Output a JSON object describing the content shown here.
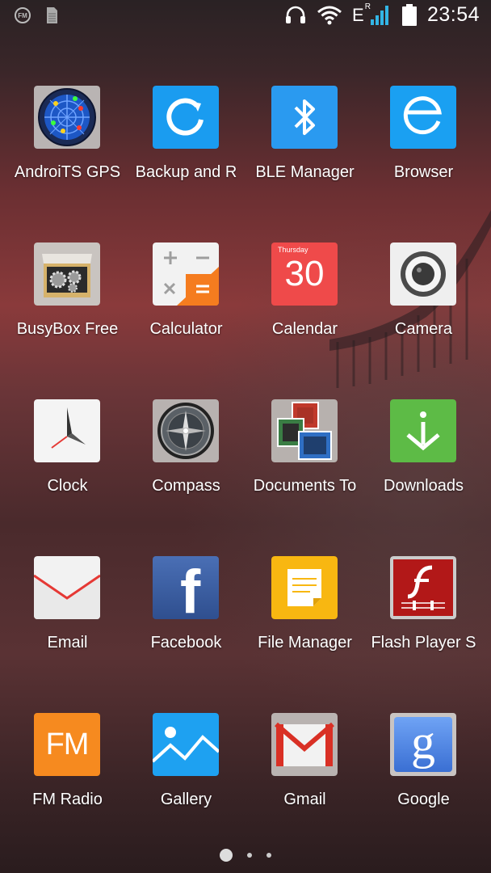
{
  "status_bar": {
    "fm_label": "FM",
    "network_type": "E",
    "roaming": "R",
    "time": "23:54"
  },
  "apps": [
    {
      "label": "AndroiTS GPS",
      "icon": "gps-radar-icon"
    },
    {
      "label": "Backup and R",
      "icon": "backup-icon"
    },
    {
      "label": "BLE Manager",
      "icon": "bluetooth-icon"
    },
    {
      "label": "Browser",
      "icon": "browser-icon"
    },
    {
      "label": "BusyBox Free",
      "icon": "busybox-icon"
    },
    {
      "label": "Calculator",
      "icon": "calculator-icon"
    },
    {
      "label": "Calendar",
      "icon": "calendar-icon",
      "day_name": "Thursday",
      "day_number": "30"
    },
    {
      "label": "Camera",
      "icon": "camera-icon"
    },
    {
      "label": "Clock",
      "icon": "clock-icon"
    },
    {
      "label": "Compass",
      "icon": "compass-icon"
    },
    {
      "label": "Documents To",
      "icon": "documents-icon"
    },
    {
      "label": "Downloads",
      "icon": "downloads-icon"
    },
    {
      "label": "Email",
      "icon": "email-icon"
    },
    {
      "label": "Facebook",
      "icon": "facebook-icon",
      "glyph": "f"
    },
    {
      "label": "File Manager",
      "icon": "file-manager-icon"
    },
    {
      "label": "Flash Player S",
      "icon": "flash-player-icon"
    },
    {
      "label": "FM Radio",
      "icon": "fm-radio-icon",
      "glyph": "FM"
    },
    {
      "label": "Gallery",
      "icon": "gallery-icon"
    },
    {
      "label": "Gmail",
      "icon": "gmail-icon"
    },
    {
      "label": "Google",
      "icon": "google-icon",
      "glyph": "g"
    }
  ],
  "pager": {
    "pages": 3,
    "active": 0
  }
}
